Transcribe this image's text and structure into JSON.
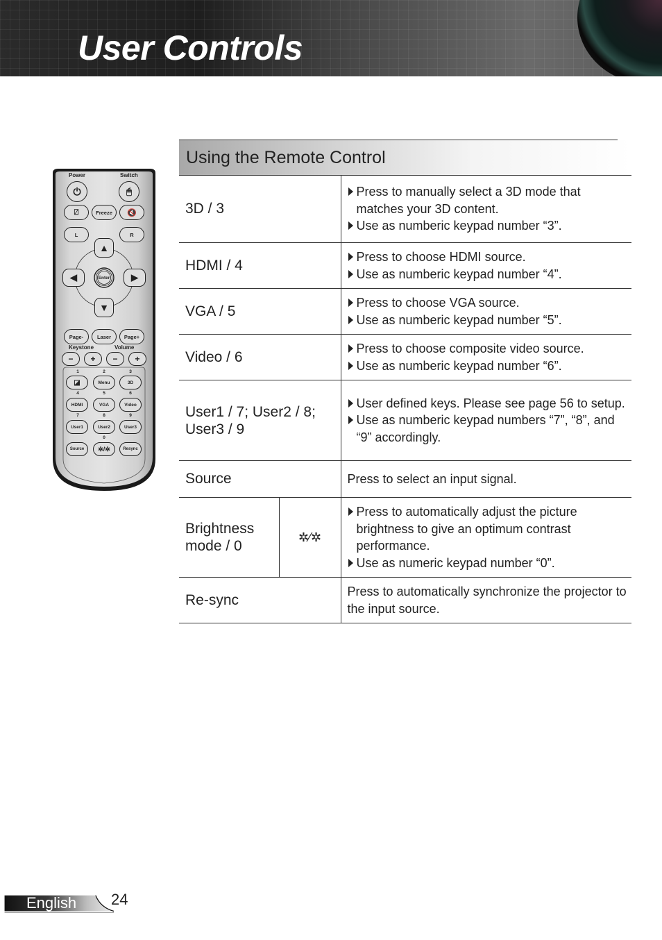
{
  "header": {
    "title": "User Controls"
  },
  "remote": {
    "labels": {
      "power": "Power",
      "switch": "Switch",
      "keystone": "Keystone",
      "volume": "Volume"
    },
    "buttons": {
      "freeze": "Freeze",
      "l": "L",
      "r": "R",
      "enter": "Enter",
      "page_minus": "Page-",
      "laser": "Laser",
      "page_plus": "Page+",
      "minus": "−",
      "plus": "+",
      "menu": "Menu",
      "three_d": "3D",
      "hdmi": "HDMI",
      "vga": "VGA",
      "video": "Video",
      "user1": "User1",
      "user2": "User2",
      "user3": "User3",
      "source": "Source",
      "resync": "Resync"
    },
    "numbers": [
      "1",
      "2",
      "3",
      "4",
      "5",
      "6",
      "7",
      "8",
      "9",
      "0"
    ]
  },
  "section": {
    "title": "Using the Remote Control"
  },
  "rows": [
    {
      "key": "3D / 3",
      "bullets": [
        "Press to manually select a 3D mode that matches your 3D content.",
        "Use as numberic keypad number “3”."
      ]
    },
    {
      "key": "HDMI / 4",
      "bullets": [
        "Press to choose HDMI source.",
        "Use as numberic keypad number “4”."
      ]
    },
    {
      "key": "VGA / 5",
      "bullets": [
        "Press to choose VGA source.",
        "Use as numberic keypad number “5”."
      ]
    },
    {
      "key": "Video / 6",
      "bullets": [
        "Press to choose composite video source.",
        "Use as numberic keypad number “6”."
      ]
    },
    {
      "key": "User1 / 7; User2 / 8; User3 / 9",
      "bullets": [
        "User defined keys. Please see page 56 to setup.",
        "Use as numberic keypad numbers “7”, “8”, and “9” accordingly."
      ]
    },
    {
      "key": "Source",
      "text": "Press to select an input signal."
    },
    {
      "key": "Brightness mode / 0",
      "icon": "brightness-mode-icon",
      "bullets": [
        "Press to automatically adjust the picture brightness to give an optimum contrast performance.",
        "Use as numeric keypad number “0”."
      ]
    },
    {
      "key": "Re-sync",
      "text": "Press to automatically synchronize the projector to the input source."
    }
  ],
  "footer": {
    "language": "English",
    "page": "24"
  }
}
